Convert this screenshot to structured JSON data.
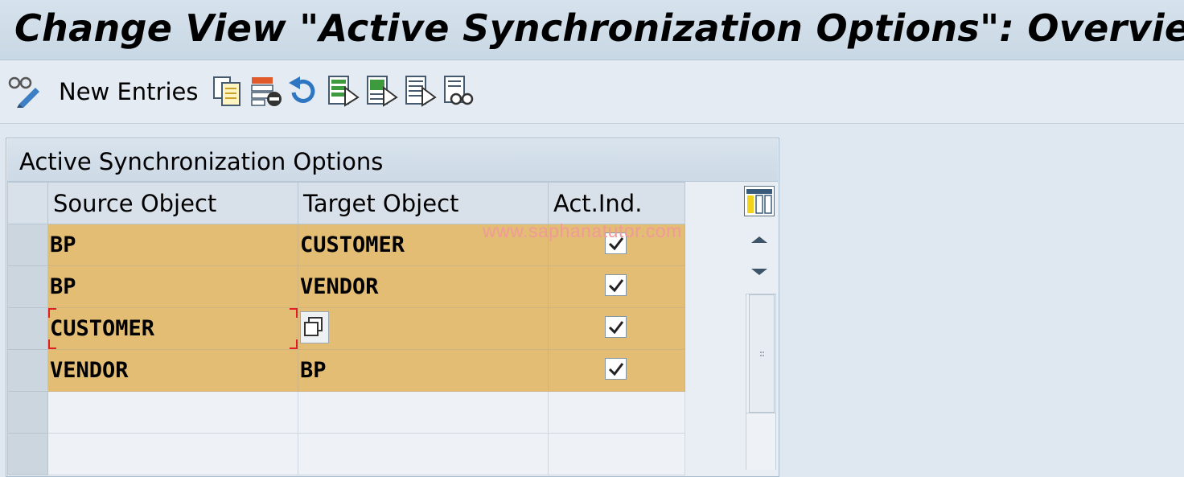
{
  "window": {
    "title": "Change View \"Active Synchronization Options\": Overview"
  },
  "toolbar": {
    "new_entries_label": "New Entries",
    "icons": [
      "display-change-icon",
      "copy-icon",
      "delete-icon",
      "undo-icon",
      "select-all-icon",
      "select-block-icon",
      "deselect-all-icon",
      "print-preview-icon"
    ]
  },
  "watermark": "www.saphanatutor.com",
  "table": {
    "title": "Active Synchronization Options",
    "columns": [
      "Source Object",
      "Target Object",
      "Act.Ind."
    ],
    "rows": [
      {
        "source": "BP",
        "target": "CUSTOMER",
        "active": true
      },
      {
        "source": "BP",
        "target": "VENDOR",
        "active": true
      },
      {
        "source": "CUSTOMER",
        "target": "",
        "active": true
      },
      {
        "source": "VENDOR",
        "target": "BP",
        "active": true
      }
    ]
  },
  "colors": {
    "row_highlight": "#e2bd73",
    "title_bar": "#cfdbe7",
    "watermark": "#f09a9a"
  }
}
